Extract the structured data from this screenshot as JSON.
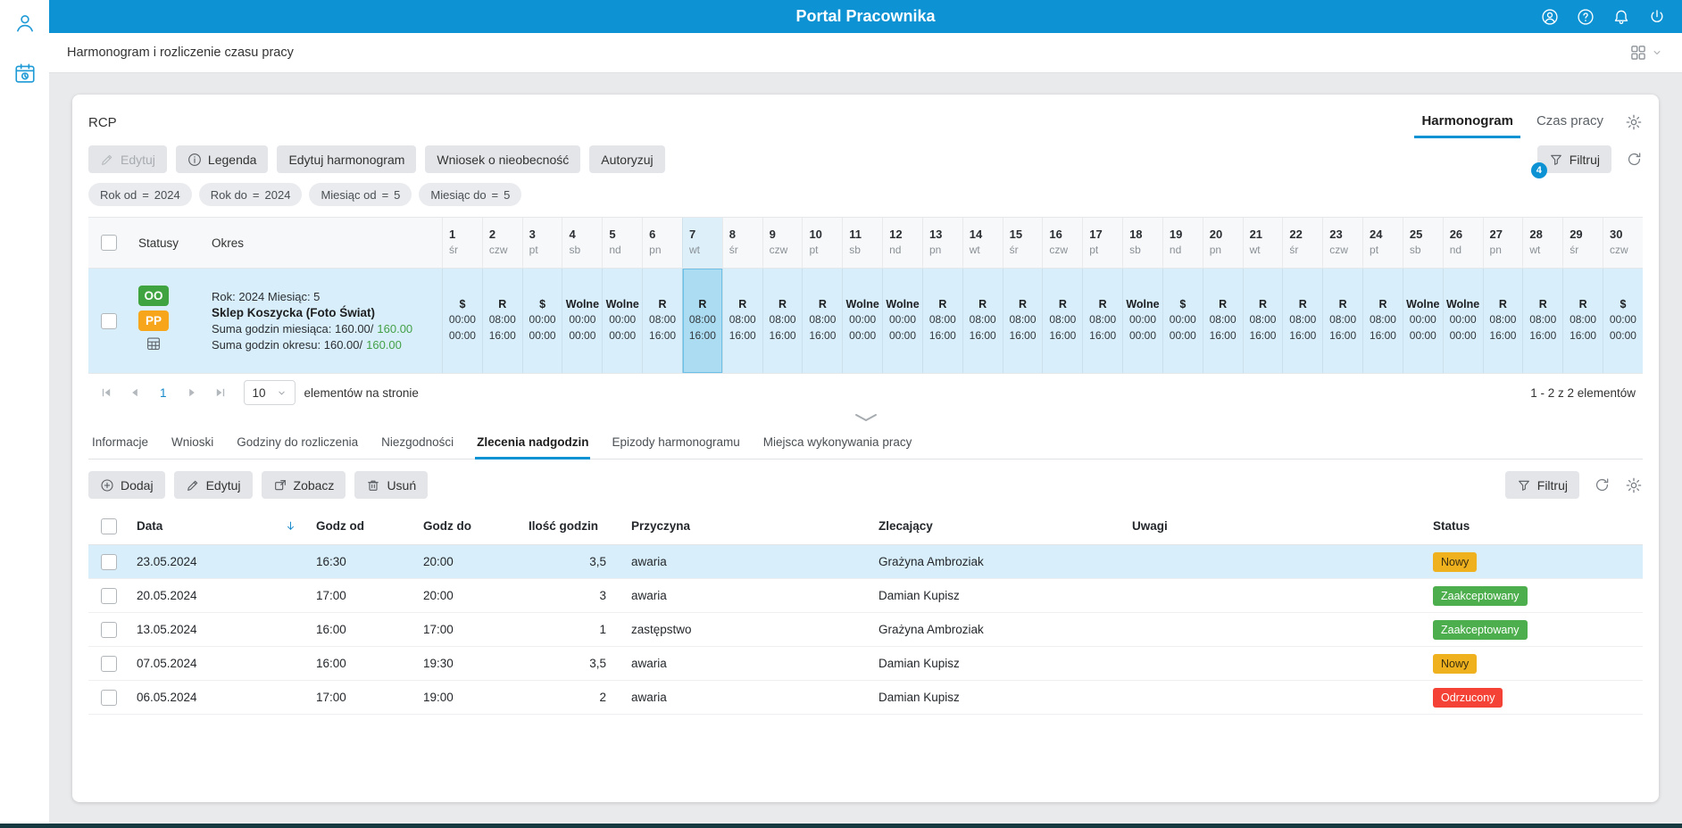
{
  "colors": {
    "accent_blue": "#0d93d4",
    "status_oo_green": "#3fa33f",
    "status_pp_orange": "#f7a61b",
    "sum_green": "#43a047",
    "badge_new": "#f0b11e",
    "badge_accepted": "#4cae4c",
    "badge_rejected": "#f44336"
  },
  "topbar": {
    "title": "Portal Pracownika"
  },
  "breadcrumb": {
    "title": "Harmonogram i rozliczenie czasu pracy"
  },
  "rcp": {
    "title": "RCP",
    "view_tabs": [
      {
        "label": "Harmonogram",
        "state": "active"
      },
      {
        "label": "Czas pracy"
      }
    ],
    "toolbar": {
      "edit": "Edytuj",
      "legend": "Legenda",
      "edit_schedule": "Edytuj harmonogram",
      "absence_request": "Wniosek o nieobecność",
      "authorize": "Autoryzuj",
      "filter": "Filtruj",
      "filter_badge": "4"
    },
    "filters": [
      {
        "label": "Rok od",
        "op": "=",
        "value": "2024"
      },
      {
        "label": "Rok do",
        "op": "=",
        "value": "2024"
      },
      {
        "label": "Miesiąc od",
        "op": "=",
        "value": "5"
      },
      {
        "label": "Miesiąc do",
        "op": "=",
        "value": "5"
      }
    ],
    "schedule": {
      "headers": {
        "statuses": "Statusy",
        "period": "Okres"
      },
      "days": [
        {
          "num": "1",
          "dow": "śr"
        },
        {
          "num": "2",
          "dow": "czw"
        },
        {
          "num": "3",
          "dow": "pt"
        },
        {
          "num": "4",
          "dow": "sb"
        },
        {
          "num": "5",
          "dow": "nd"
        },
        {
          "num": "6",
          "dow": "pn"
        },
        {
          "num": "7",
          "dow": "wt",
          "state": "selected"
        },
        {
          "num": "8",
          "dow": "śr"
        },
        {
          "num": "9",
          "dow": "czw"
        },
        {
          "num": "10",
          "dow": "pt"
        },
        {
          "num": "11",
          "dow": "sb"
        },
        {
          "num": "12",
          "dow": "nd"
        },
        {
          "num": "13",
          "dow": "pn"
        },
        {
          "num": "14",
          "dow": "wt"
        },
        {
          "num": "15",
          "dow": "śr"
        },
        {
          "num": "16",
          "dow": "czw"
        },
        {
          "num": "17",
          "dow": "pt"
        },
        {
          "num": "18",
          "dow": "sb"
        },
        {
          "num": "19",
          "dow": "nd"
        },
        {
          "num": "20",
          "dow": "pn"
        },
        {
          "num": "21",
          "dow": "wt"
        },
        {
          "num": "22",
          "dow": "śr"
        },
        {
          "num": "23",
          "dow": "czw"
        },
        {
          "num": "24",
          "dow": "pt"
        },
        {
          "num": "25",
          "dow": "sb"
        },
        {
          "num": "26",
          "dow": "nd"
        },
        {
          "num": "27",
          "dow": "pn"
        },
        {
          "num": "28",
          "dow": "wt"
        },
        {
          "num": "29",
          "dow": "śr"
        },
        {
          "num": "30",
          "dow": "czw"
        }
      ],
      "row": {
        "status_badges": [
          {
            "label": "OO",
            "kind": "oo"
          },
          {
            "label": "PP",
            "kind": "pp"
          }
        ],
        "period": {
          "line1": "Rok: 2024 Miesiąc: 5",
          "line2": "Sklep Koszycka (Foto Świat)",
          "month_sum_label": "Suma godzin miesiąca: 160.00/",
          "month_sum_value": "160.00",
          "period_sum_label": "Suma godzin okresu: 160.00/",
          "period_sum_value": "160.00"
        },
        "cells": [
          {
            "label": "$",
            "from": "00:00",
            "to": "00:00",
            "kind": "holiday"
          },
          {
            "label": "R",
            "from": "08:00",
            "to": "16:00",
            "kind": "work"
          },
          {
            "label": "$",
            "from": "00:00",
            "to": "00:00",
            "kind": "holiday"
          },
          {
            "label": "Wolne",
            "from": "00:00",
            "to": "00:00",
            "kind": "free"
          },
          {
            "label": "Wolne",
            "from": "00:00",
            "to": "00:00",
            "kind": "free"
          },
          {
            "label": "R",
            "from": "08:00",
            "to": "16:00",
            "kind": "work"
          },
          {
            "label": "R",
            "from": "08:00",
            "to": "16:00",
            "kind": "work",
            "state": "selected"
          },
          {
            "label": "R",
            "from": "08:00",
            "to": "16:00",
            "kind": "work"
          },
          {
            "label": "R",
            "from": "08:00",
            "to": "16:00",
            "kind": "work"
          },
          {
            "label": "R",
            "from": "08:00",
            "to": "16:00",
            "kind": "work"
          },
          {
            "label": "Wolne",
            "from": "00:00",
            "to": "00:00",
            "kind": "free"
          },
          {
            "label": "Wolne",
            "from": "00:00",
            "to": "00:00",
            "kind": "free"
          },
          {
            "label": "R",
            "from": "08:00",
            "to": "16:00",
            "kind": "work"
          },
          {
            "label": "R",
            "from": "08:00",
            "to": "16:00",
            "kind": "work"
          },
          {
            "label": "R",
            "from": "08:00",
            "to": "16:00",
            "kind": "work"
          },
          {
            "label": "R",
            "from": "08:00",
            "to": "16:00",
            "kind": "work"
          },
          {
            "label": "R",
            "from": "08:00",
            "to": "16:00",
            "kind": "work"
          },
          {
            "label": "Wolne",
            "from": "00:00",
            "to": "00:00",
            "kind": "free"
          },
          {
            "label": "$",
            "from": "00:00",
            "to": "00:00",
            "kind": "holiday"
          },
          {
            "label": "R",
            "from": "08:00",
            "to": "16:00",
            "kind": "work"
          },
          {
            "label": "R",
            "from": "08:00",
            "to": "16:00",
            "kind": "work"
          },
          {
            "label": "R",
            "from": "08:00",
            "to": "16:00",
            "kind": "work"
          },
          {
            "label": "R",
            "from": "08:00",
            "to": "16:00",
            "kind": "work"
          },
          {
            "label": "R",
            "from": "08:00",
            "to": "16:00",
            "kind": "work"
          },
          {
            "label": "Wolne",
            "from": "00:00",
            "to": "00:00",
            "kind": "free"
          },
          {
            "label": "Wolne",
            "from": "00:00",
            "to": "00:00",
            "kind": "free"
          },
          {
            "label": "R",
            "from": "08:00",
            "to": "16:00",
            "kind": "work"
          },
          {
            "label": "R",
            "from": "08:00",
            "to": "16:00",
            "kind": "work"
          },
          {
            "label": "R",
            "from": "08:00",
            "to": "16:00",
            "kind": "work"
          },
          {
            "label": "$",
            "from": "00:00",
            "to": "00:00",
            "kind": "holiday"
          }
        ]
      }
    },
    "pagination": {
      "page": "1",
      "page_size": "10",
      "per_page_label": "elementów na stronie",
      "range_label": "1 - 2 z 2 elementów"
    }
  },
  "details": {
    "tabs": [
      {
        "label": "Informacje"
      },
      {
        "label": "Wnioski"
      },
      {
        "label": "Godziny do rozliczenia"
      },
      {
        "label": "Niezgodności"
      },
      {
        "label": "Zlecenia nadgodzin",
        "state": "active"
      },
      {
        "label": "Epizody harmonogramu"
      },
      {
        "label": "Miejsca wykonywania pracy"
      }
    ],
    "toolbar": {
      "add": "Dodaj",
      "edit": "Edytuj",
      "view": "Zobacz",
      "delete": "Usuń",
      "filter": "Filtruj"
    },
    "table": {
      "headers": {
        "date": "Data",
        "from": "Godz od",
        "to": "Godz do",
        "hours": "Ilość godzin",
        "reason": "Przyczyna",
        "orderer": "Zlecający",
        "notes": "Uwagi",
        "status": "Status"
      },
      "rows": [
        {
          "date": "23.05.2024",
          "from": "16:30",
          "to": "20:00",
          "hours": "3,5",
          "reason": "awaria",
          "orderer": "Grażyna Ambroziak",
          "notes": "",
          "status": "Nowy",
          "status_kind": "new",
          "state": "selected"
        },
        {
          "date": "20.05.2024",
          "from": "17:00",
          "to": "20:00",
          "hours": "3",
          "reason": "awaria",
          "orderer": "Damian Kupisz",
          "notes": "",
          "status": "Zaakceptowany",
          "status_kind": "accepted"
        },
        {
          "date": "13.05.2024",
          "from": "16:00",
          "to": "17:00",
          "hours": "1",
          "reason": "zastępstwo",
          "orderer": "Grażyna Ambroziak",
          "notes": "",
          "status": "Zaakceptowany",
          "status_kind": "accepted"
        },
        {
          "date": "07.05.2024",
          "from": "16:00",
          "to": "19:30",
          "hours": "3,5",
          "reason": "awaria",
          "orderer": "Damian Kupisz",
          "notes": "",
          "status": "Nowy",
          "status_kind": "new"
        },
        {
          "date": "06.05.2024",
          "from": "17:00",
          "to": "19:00",
          "hours": "2",
          "reason": "awaria",
          "orderer": "Damian Kupisz",
          "notes": "",
          "status": "Odrzucony",
          "status_kind": "rejected"
        }
      ]
    }
  }
}
